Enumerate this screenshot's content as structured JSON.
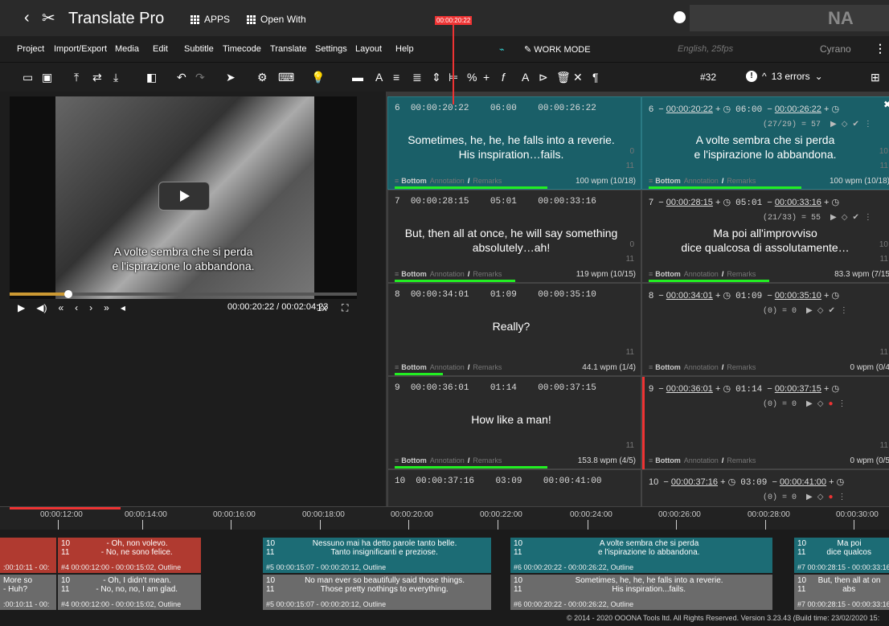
{
  "title_bar": {
    "back": "‹",
    "title": "Translate Pro",
    "apps": "APPS",
    "open_with": "Open With",
    "brand": "NA"
  },
  "menu": {
    "items": [
      "Project",
      "Import/Export",
      "Media",
      "Edit",
      "Subtitle",
      "Timecode",
      "Translate",
      "Settings",
      "Layout",
      "Help"
    ],
    "work_mode": "WORK MODE",
    "language": "English, 25fps",
    "user": "Cyrano",
    "more": "⋮"
  },
  "toolbar": {
    "counter": "#32",
    "errors": "13 errors"
  },
  "video": {
    "subtitle_line1": "A volte sembra che si perda",
    "subtitle_line2": "e l'ispirazione lo abbandona.",
    "timecode": "00:00:20:22 / 00:02:04:23",
    "rate": "1x",
    "progress": 0.17
  },
  "subtitles": [
    {
      "left": {
        "id": "6",
        "in": "00:00:20:22",
        "dur": "06:00",
        "out": "00:00:26:22",
        "line1": "Sometimes, he, he, he falls into a reverie.",
        "line2": "His inspiration…fails.",
        "n1": "0",
        "n2": "11",
        "wpm": "100 wpm (10/18)"
      },
      "right": {
        "id": "6",
        "in": "00:00:20:22",
        "dur": "06:00",
        "out": "00:00:26:22",
        "stat": "(27/29) = 57",
        "line1": "A volte sembra che si perda",
        "line2": "e l'ispirazione lo abbandona.",
        "n1": "10",
        "n2": "11",
        "wpm": "100 wpm (10/18)"
      }
    },
    {
      "left": {
        "id": "7",
        "in": "00:00:28:15",
        "dur": "05:01",
        "out": "00:00:33:16",
        "line1": "But, then all at once, he will say something",
        "line2": "absolutely…ah!",
        "n1": "0",
        "n2": "11",
        "wpm": "119 wpm (10/15)"
      },
      "right": {
        "id": "7",
        "in": "00:00:28:15",
        "dur": "05:01",
        "out": "00:00:33:16",
        "stat": "(21/33) = 55",
        "line1": "Ma poi all'improvviso",
        "line2": "dice qualcosa di assolutamente…",
        "n1": "10",
        "n2": "11",
        "wpm": "83.3 wpm (7/15"
      }
    },
    {
      "left": {
        "id": "8",
        "in": "00:00:34:01",
        "dur": "01:09",
        "out": "00:00:35:10",
        "line1": "",
        "line2": "Really?",
        "n1": "",
        "n2": "11",
        "wpm": "44.1 wpm (1/4)"
      },
      "right": {
        "id": "8",
        "in": "00:00:34:01",
        "dur": "01:09",
        "out": "00:00:35:10",
        "stat": "(0) = 0",
        "line1": "",
        "line2": "",
        "n1": "",
        "n2": "11",
        "wpm": "0 wpm (0/4"
      }
    },
    {
      "left": {
        "id": "9",
        "in": "00:00:36:01",
        "dur": "01:14",
        "out": "00:00:37:15",
        "line1": "",
        "line2": "How like a man!",
        "n1": "",
        "n2": "11",
        "wpm": "153.8 wpm (4/5)"
      },
      "right": {
        "id": "9",
        "in": "00:00:36:01",
        "dur": "01:14",
        "out": "00:00:37:15",
        "stat": "(0) = 0",
        "line1": "",
        "line2": "",
        "n1": "",
        "n2": "11",
        "wpm": "0 wpm (0/5"
      }
    },
    {
      "left": {
        "id": "10",
        "in": "00:00:37:16",
        "dur": "03:09",
        "out": "00:00:41:00"
      },
      "right": {
        "id": "10",
        "in": "00:00:37:16",
        "dur": "03:09",
        "out": "00:00:41:00",
        "stat": "(0) = 0"
      }
    }
  ],
  "footer_labels": {
    "bottom": "Bottom",
    "annotation": "Annotation",
    "remarks": "Remarks"
  },
  "timeline": {
    "ticks": [
      "00:00:12:00",
      "00:00:14:00",
      "00:00:16:00",
      "00:00:18:00",
      "00:00:20:00",
      "00:00:22:00",
      "00:00:24:00",
      "00:00:26:00",
      "00:00:28:00",
      "00:00:30:00"
    ],
    "playhead": "00:00:20:22",
    "track1": [
      {
        "l1": "- Oh, non volevo.",
        "l2": "- No, ne sono felice.",
        "meta": "#4 00:00:12:00 - 00:00:15:02, Outline",
        "pre": ":00:10:11 - 00:"
      },
      {
        "l1": "Nessuno mai ha detto parole tanto belle.",
        "l2": "Tanto insignificanti e preziose.",
        "meta": "#5 00:00:15:07 - 00:00:20:12, Outline"
      },
      {
        "l1": "A volte sembra che si perda",
        "l2": "e l'ispirazione lo abbandona.",
        "meta": "#6 00:00:20:22 - 00:00:26:22, Outline"
      },
      {
        "l1": "Ma poi",
        "l2": "dice qualcos",
        "meta": "#7 00:00:28:15 - 00:00:33:16,"
      }
    ],
    "track2": [
      {
        "l1": "- Oh, I didn't mean.",
        "l2": "- No, no, no, I am glad.",
        "meta": "#4 00:00:12:00 - 00:00:15:02, Outline",
        "pre1": "More so",
        "pre2": "- Huh?",
        "pre3": ":00:10:11 - 00:"
      },
      {
        "l1": "No man ever so beautifully said those things.",
        "l2": "Those pretty nothings to everything.",
        "meta": "#5 00:00:15:07 - 00:00:20:12, Outline"
      },
      {
        "l1": "Sometimes, he, he, he falls into a reverie.",
        "l2": "His inspiration...fails.",
        "meta": "#6 00:00:20:22 - 00:00:26:22, Outline"
      },
      {
        "l1": "But, then all at on",
        "l2": "abs",
        "meta": "#7 00:00:28:15 - 00:00:33:16,"
      }
    ]
  },
  "footer": "© 2014 - 2020 OOONA Tools ltd. All Rights Reserved. Version 3.23.43 (Build time: 23/02/2020 15:"
}
